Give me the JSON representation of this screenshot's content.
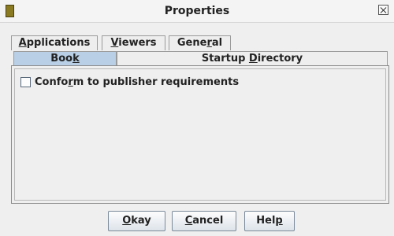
{
  "window": {
    "title": "Properties"
  },
  "tabs_row1": [
    {
      "pre": "",
      "mnemonic": "A",
      "post": "pplications"
    },
    {
      "pre": "",
      "mnemonic": "V",
      "post": "iewers"
    },
    {
      "pre": "Gene",
      "mnemonic": "r",
      "post": "al"
    }
  ],
  "tabs_row2": [
    {
      "pre": "Boo",
      "mnemonic": "k",
      "post": "",
      "selected": true
    },
    {
      "pre": "Startup ",
      "mnemonic": "D",
      "post": "irectory",
      "selected": false
    }
  ],
  "book_panel": {
    "checkbox": {
      "pre": "Confo",
      "mnemonic": "r",
      "post": "m to publisher requirements",
      "checked": false
    }
  },
  "buttons": {
    "okay": {
      "pre": "",
      "mnemonic": "O",
      "post": "kay"
    },
    "cancel": {
      "pre": "",
      "mnemonic": "C",
      "post": "ancel"
    },
    "help": {
      "pre": "Hel",
      "mnemonic": "p",
      "post": ""
    }
  },
  "colors": {
    "selected_tab": "#b8cfe5",
    "background": "#efefef"
  },
  "icons": {
    "app": "book-icon",
    "close": "close-icon"
  }
}
